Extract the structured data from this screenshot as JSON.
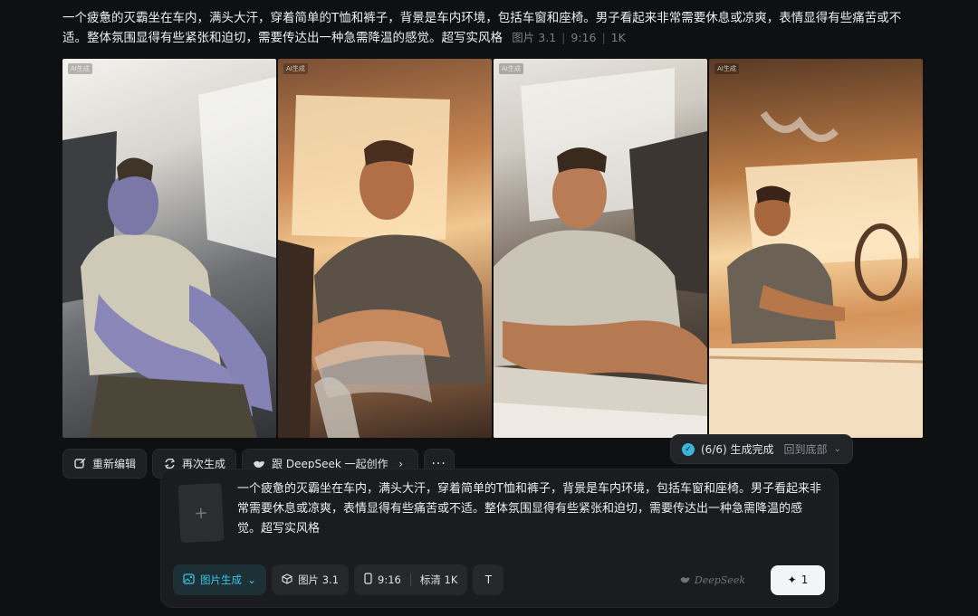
{
  "header": {
    "prompt": "一个疲惫的灭霸坐在车内，满头大汗，穿着简单的T恤和裤子，背景是车内环境，包括车窗和座椅。男子看起来非常需要休息或凉爽，表情显得有些痛苦或不适。整体氛围显得有些紧张和迫切，需要传达出一种急需降温的感觉。超写实风格",
    "model": "图片 3.1",
    "ratio": "9:16",
    "resolution": "1K"
  },
  "images": [
    {
      "tag": "AI生成"
    },
    {
      "tag": "AI生成"
    },
    {
      "tag": "AI生成"
    },
    {
      "tag": "AI生成"
    }
  ],
  "actions": {
    "reedit": "重新编辑",
    "regenerate": "再次生成",
    "create_with_deepseek": "跟 DeepSeek 一起创作",
    "more": "···"
  },
  "status": {
    "progress_text": "(6/6) 生成完成",
    "jump_label": "回到底部"
  },
  "composer": {
    "text": "一个疲惫的灭霸坐在车内，满头大汗，穿着简单的T恤和裤子，背景是车内环境，包括车窗和座椅。男子看起来非常需要休息或凉爽，表情显得有些痛苦或不适。整体氛围显得有些紧张和迫切，需要传达出一种急需降温的感觉。超写实风格",
    "mode_label": "图片生成",
    "model_label": "图片 3.1",
    "ratio_label": "9:16",
    "quality_label": "标清 1K",
    "text_tool_label": "T",
    "brand": "DeepSeek",
    "send_count": "1"
  },
  "colors": {
    "accent": "#39b7d8",
    "background": "#0f1012"
  }
}
